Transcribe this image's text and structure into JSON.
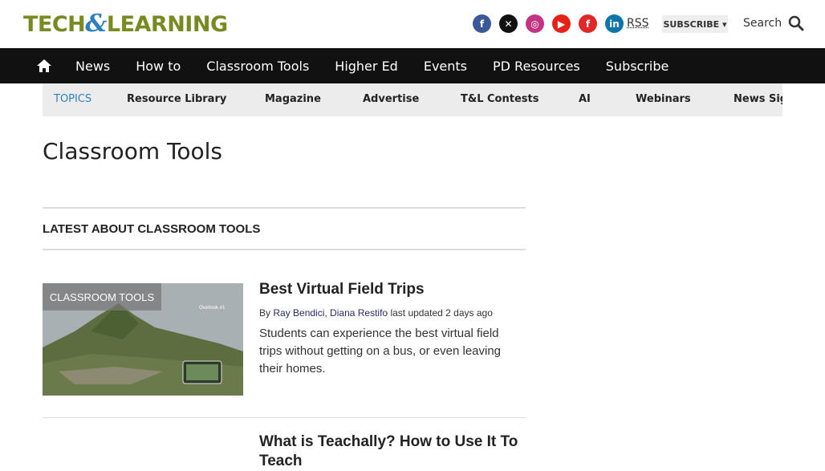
{
  "header": {
    "logo_left": "TECH",
    "logo_amp": "&",
    "logo_right": "LEARNING",
    "social": [
      {
        "name": "facebook-icon",
        "glyph": "f",
        "color": "#3b5998"
      },
      {
        "name": "x-icon",
        "glyph": "✕",
        "color": "#111111"
      },
      {
        "name": "instagram-icon",
        "glyph": "◎",
        "color": "#c13584"
      },
      {
        "name": "youtube-icon",
        "glyph": "▶",
        "color": "#e62117"
      },
      {
        "name": "flipboard-icon",
        "glyph": "f",
        "color": "#e12828"
      },
      {
        "name": "linkedin-icon",
        "glyph": "in",
        "color": "#0e76a8"
      }
    ],
    "rss": "RSS",
    "subscribe": "SUBSCRIBE ▾",
    "search": "Search"
  },
  "nav": {
    "items": [
      "News",
      "How to",
      "Classroom Tools",
      "Higher Ed",
      "Events",
      "PD Resources",
      "Subscribe"
    ]
  },
  "topics": {
    "label": "TOPICS",
    "items": [
      "Resource Library",
      "Magazine",
      "Advertise",
      "T&L Contests",
      "AI",
      "Webinars",
      "News Sig"
    ]
  },
  "page_title": "Classroom Tools",
  "section_heading": "LATEST ABOUT CLASSROOM TOOLS",
  "articles": [
    {
      "badge": "CLASSROOM TOOLS",
      "title": "Best Virtual Field Trips",
      "by": "By",
      "authors": "Ray Bendici, Diana Restifo",
      "updated": "last updated 2 days ago",
      "excerpt": "Students can experience the best virtual field trips without getting on a bus, or even leaving their homes.",
      "image_overlay": "Overlook #1"
    },
    {
      "title": "What is Teachally? How to Use It To Teach"
    }
  ]
}
